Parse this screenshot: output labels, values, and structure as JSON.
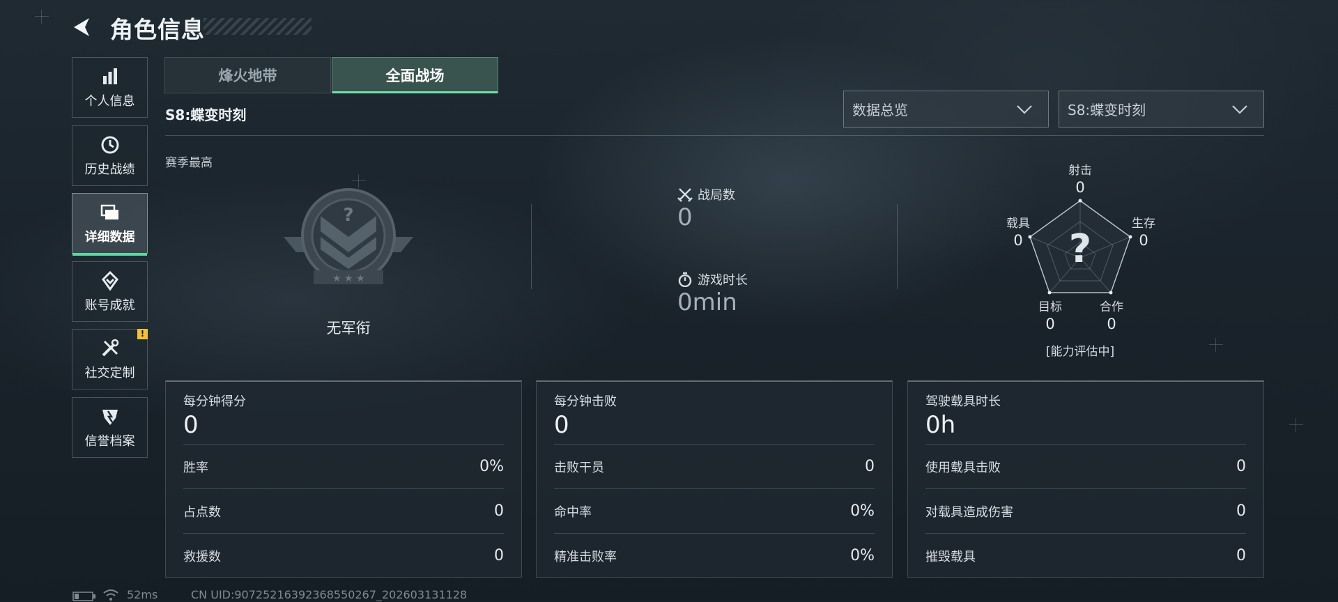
{
  "header": {
    "title": "角色信息"
  },
  "sidebar": {
    "items": [
      {
        "label": "个人信息",
        "icon": "bar-chart-icon"
      },
      {
        "label": "历史战绩",
        "icon": "history-clock-icon"
      },
      {
        "label": "详细数据",
        "icon": "folders-icon",
        "active": true
      },
      {
        "label": "账号成就",
        "icon": "medal-icon"
      },
      {
        "label": "社交定制",
        "icon": "tools-icon",
        "badge": "!"
      },
      {
        "label": "信誉档案",
        "icon": "shield-icon"
      }
    ]
  },
  "mode_tabs": [
    {
      "label": "烽火地带",
      "active": false
    },
    {
      "label": "全面战场",
      "active": true
    }
  ],
  "season": {
    "name": "S8:蝶变时刻",
    "best_label": "赛季最高"
  },
  "dropdowns": {
    "view": {
      "value": "数据总览"
    },
    "season": {
      "value": "S8:蝶变时刻"
    }
  },
  "rank": {
    "name": "无军衔",
    "emblem_glyph": "?"
  },
  "stats": {
    "matches": {
      "label": "战局数",
      "value": "0",
      "icon": "crossed-swords-icon"
    },
    "playtime": {
      "label": "游戏时长",
      "value": "0min",
      "icon": "stopwatch-icon"
    }
  },
  "radar": {
    "axes": [
      {
        "label": "射击",
        "value": "0"
      },
      {
        "label": "生存",
        "value": "0"
      },
      {
        "label": "合作",
        "value": "0"
      },
      {
        "label": "目标",
        "value": "0"
      },
      {
        "label": "载具",
        "value": "0"
      }
    ],
    "center_glyph": "?",
    "status": "[能力评估中]"
  },
  "panels": [
    {
      "title": "每分钟得分",
      "value": "0",
      "rows": [
        {
          "label": "胜率",
          "value": "0%"
        },
        {
          "label": "占点数",
          "value": "0"
        },
        {
          "label": "救援数",
          "value": "0"
        }
      ]
    },
    {
      "title": "每分钟击败",
      "value": "0",
      "rows": [
        {
          "label": "击败干员",
          "value": "0"
        },
        {
          "label": "命中率",
          "value": "0%"
        },
        {
          "label": "精准击败率",
          "value": "0%"
        }
      ]
    },
    {
      "title": "驾驶载具时长",
      "value": "0h",
      "rows": [
        {
          "label": "使用载具击败",
          "value": "0"
        },
        {
          "label": "对载具造成伤害",
          "value": "0"
        },
        {
          "label": "摧毁载具",
          "value": "0"
        }
      ]
    }
  ],
  "footer": {
    "ping": "52ms",
    "uid": "CN UID:90725216392368550267_202603131128"
  },
  "colors": {
    "accent": "#5fd6a4",
    "badge": "#f2c230",
    "background": "#1b242c"
  }
}
